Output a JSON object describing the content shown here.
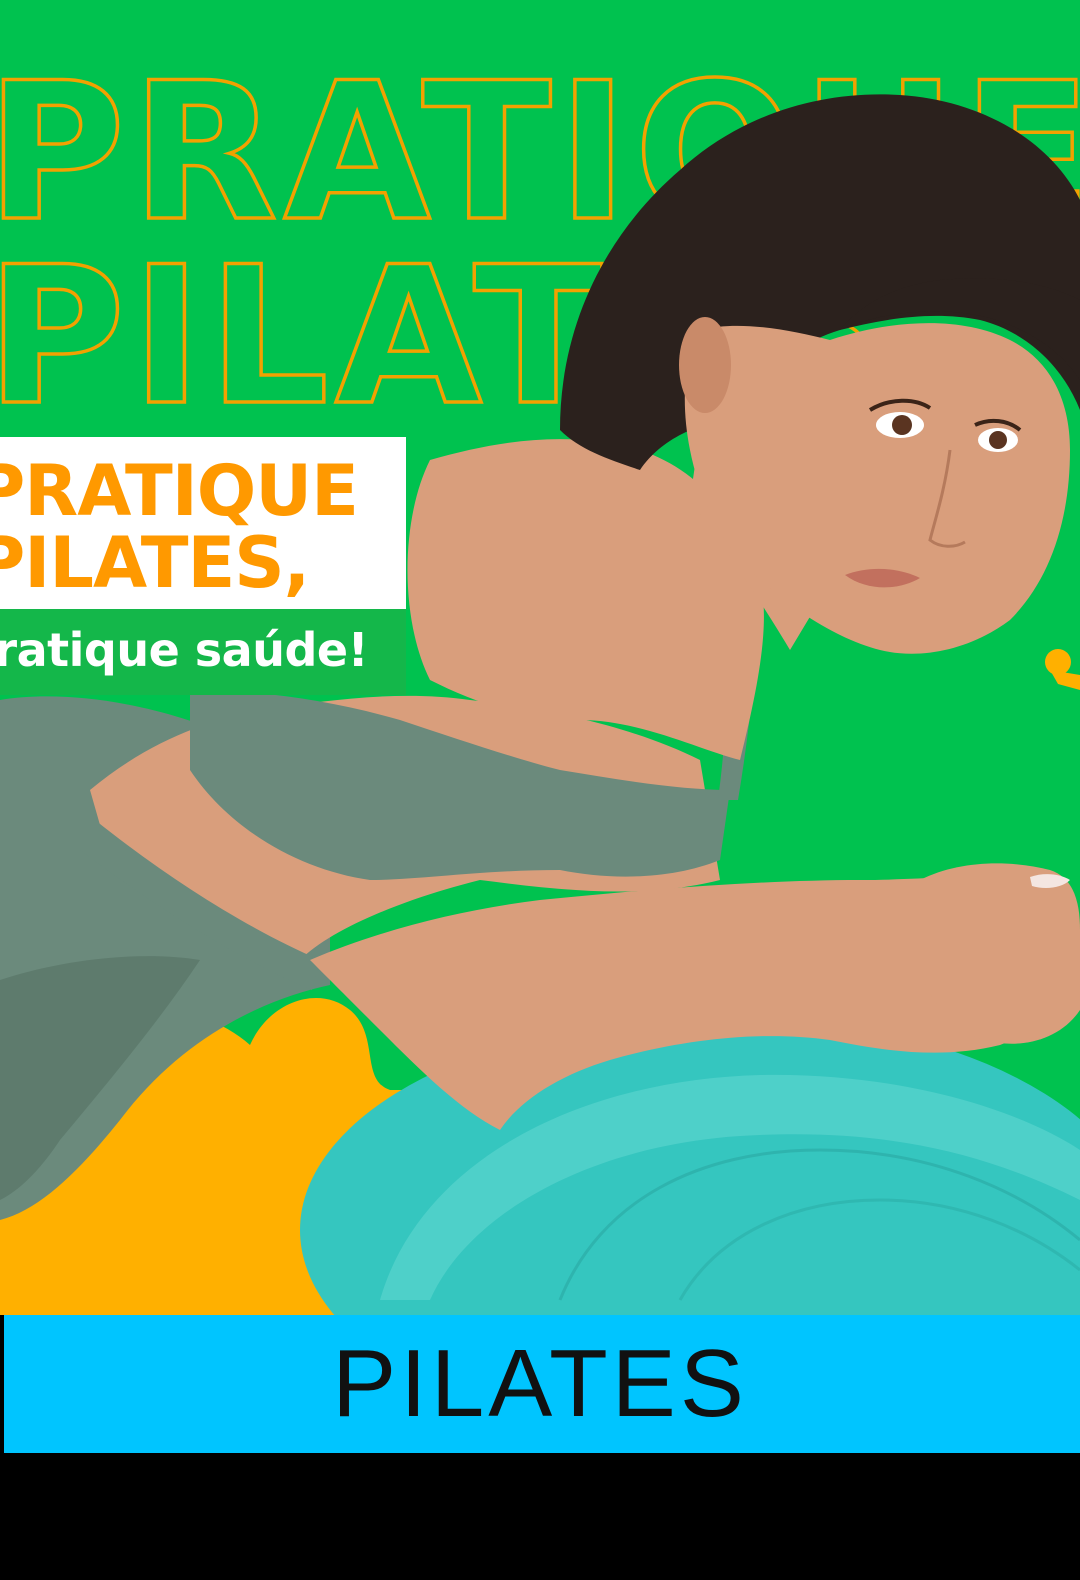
{
  "colors": {
    "background_green": "#00c24f",
    "accent_orange": "#ffb000",
    "outline_orange": "#f2a100",
    "headline_orange": "#ff9900",
    "tagline_green": "#14b74a",
    "bar_blue": "#00c5ff",
    "bottom_black": "#000000",
    "skin": "#d99e7c",
    "hair": "#2b211d",
    "outfit": "#6b8a7c",
    "ball": "#35c6bf"
  },
  "background_text": {
    "line_1": "PRATIQUE",
    "line_2": "PILATES"
  },
  "headline": {
    "line_1": "PRATIQUE",
    "line_2": "PILATES,"
  },
  "tagline": {
    "text": "pratique saúde!"
  },
  "category_bar": {
    "label": "PILATES"
  },
  "icons": {
    "photo": "woman-on-exercise-ball-photo",
    "decor": "orange-blob-shape"
  }
}
